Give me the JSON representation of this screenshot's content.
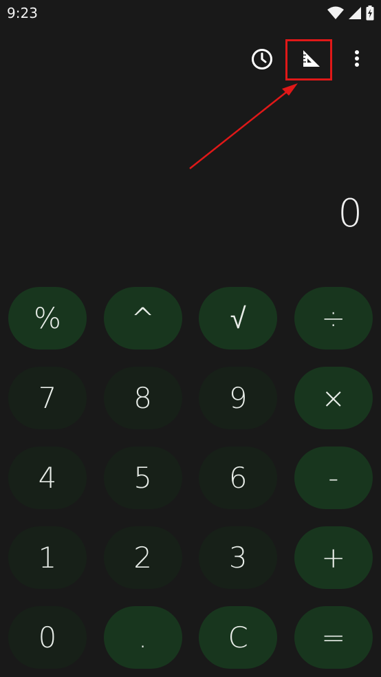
{
  "status": {
    "time": "9:23"
  },
  "icons": {
    "wifi": "wifi-icon",
    "signal": "signal-icon",
    "battery": "battery-charging-icon",
    "history": "history-clock-icon",
    "unit_converter": "set-square-ruler-icon",
    "more": "more-vert-icon"
  },
  "display": {
    "value": "0"
  },
  "keys": [
    {
      "label": "%",
      "kind": "op",
      "name": "percent-key"
    },
    {
      "label": "^",
      "kind": "op",
      "name": "power-key"
    },
    {
      "label": "√",
      "kind": "op",
      "name": "square-root-key"
    },
    {
      "label": "÷",
      "kind": "op",
      "name": "divide-key"
    },
    {
      "label": "7",
      "kind": "num",
      "name": "digit-7-key"
    },
    {
      "label": "8",
      "kind": "num",
      "name": "digit-8-key"
    },
    {
      "label": "9",
      "kind": "num",
      "name": "digit-9-key"
    },
    {
      "label": "×",
      "kind": "op",
      "name": "multiply-key"
    },
    {
      "label": "4",
      "kind": "num",
      "name": "digit-4-key"
    },
    {
      "label": "5",
      "kind": "num",
      "name": "digit-5-key"
    },
    {
      "label": "6",
      "kind": "num",
      "name": "digit-6-key"
    },
    {
      "label": "-",
      "kind": "op",
      "name": "subtract-key"
    },
    {
      "label": "1",
      "kind": "num",
      "name": "digit-1-key"
    },
    {
      "label": "2",
      "kind": "num",
      "name": "digit-2-key"
    },
    {
      "label": "3",
      "kind": "num",
      "name": "digit-3-key"
    },
    {
      "label": "+",
      "kind": "op",
      "name": "add-key"
    },
    {
      "label": "0",
      "kind": "num",
      "name": "digit-0-key"
    },
    {
      "label": ".",
      "kind": "op",
      "name": "decimal-point-key"
    },
    {
      "label": "C",
      "kind": "op",
      "name": "clear-key"
    },
    {
      "label": "=",
      "kind": "op",
      "name": "equals-key"
    }
  ],
  "colors": {
    "background": "#191919",
    "operator_key": "#18361e",
    "number_key": "#172018",
    "annotation": "#e01818"
  }
}
